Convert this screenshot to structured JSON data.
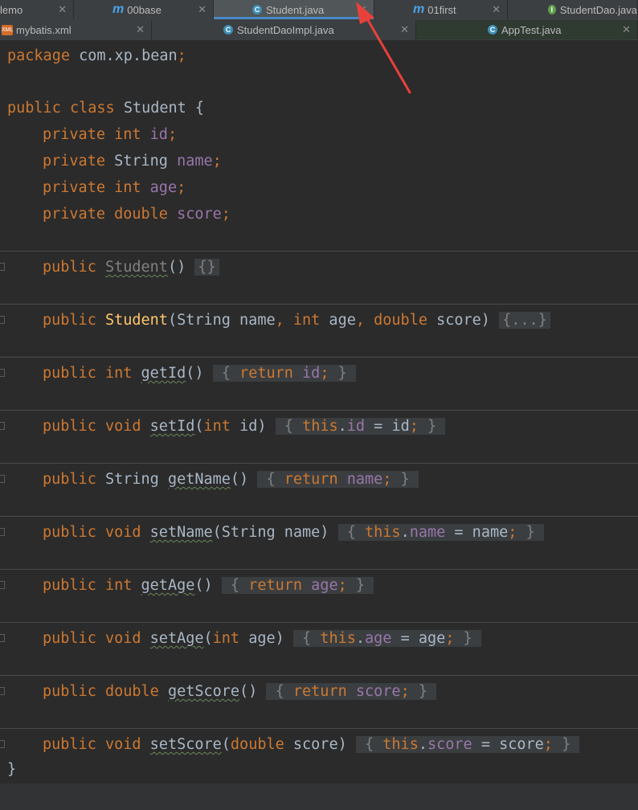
{
  "tabs_row1": [
    {
      "label": "lemo",
      "icon": "none",
      "active": false
    },
    {
      "label": "00base",
      "icon": "module-icon",
      "active": false
    },
    {
      "label": "Student.java",
      "icon": "class-icon",
      "active": true
    },
    {
      "label": "01first",
      "icon": "module-icon",
      "active": false
    },
    {
      "label": "StudentDao.java",
      "icon": "interface-icon",
      "active": false
    }
  ],
  "tabs_row2": [
    {
      "label": "mybatis.xml",
      "icon": "xml-icon",
      "active": false
    },
    {
      "label": "StudentDaoImpl.java",
      "icon": "class-icon",
      "active": false
    },
    {
      "label": "AppTest.java",
      "icon": "test-class-icon",
      "active": false
    }
  ],
  "code": {
    "package_kw": "package",
    "package_name": "com.xp.bean",
    "class_public": "public",
    "class_kw": "class",
    "class_name": "Student",
    "fields": [
      {
        "mod": "private",
        "type": "int",
        "name": "id"
      },
      {
        "mod": "private",
        "type": "String",
        "name": "name"
      },
      {
        "mod": "private",
        "type": "int",
        "name": "age"
      },
      {
        "mod": "private",
        "type": "double",
        "name": "score"
      }
    ],
    "methods": [
      {
        "sig": "public Student()",
        "body": "{}"
      },
      {
        "sig": "public Student(String name, int age, double score)",
        "body": "{...}"
      },
      {
        "sig": "public int getId()",
        "body": "{ return id; }"
      },
      {
        "sig": "public void setId(int id)",
        "body": "{ this.id = id; }"
      },
      {
        "sig": "public String getName()",
        "body": "{ return name; }"
      },
      {
        "sig": "public void setName(String name)",
        "body": "{ this.name = name; }"
      },
      {
        "sig": "public int getAge()",
        "body": "{ return age; }"
      },
      {
        "sig": "public void setAge(int age)",
        "body": "{ this.age = age; }"
      },
      {
        "sig": "public double getScore()",
        "body": "{ return score; }"
      },
      {
        "sig": "public void setScore(double score)",
        "body": "{ this.score = score; }"
      }
    ],
    "closing_brace": "}"
  },
  "colors": {
    "background": "#2b2b2b",
    "keyword": "#cc7832",
    "field": "#9876aa",
    "method_decl": "#ffc66d",
    "text": "#a9b7c6",
    "annotation_arrow": "#e8413b"
  }
}
